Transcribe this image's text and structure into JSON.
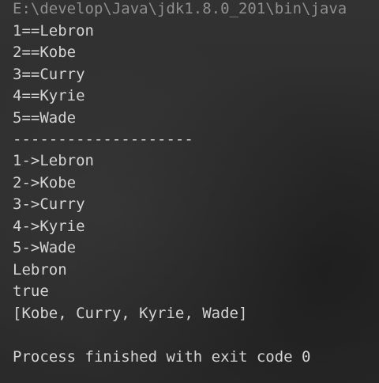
{
  "console": {
    "command": "E:\\develop\\Java\\jdk1.8.0_201\\bin\\java",
    "lines": [
      "1==Lebron",
      "2==Kobe",
      "3==Curry",
      "4==Kyrie",
      "5==Wade",
      "--------------------",
      "1->Lebron",
      "2->Kobe",
      "3->Curry",
      "4->Kyrie",
      "5->Wade",
      "Lebron",
      "true",
      "[Kobe, Curry, Kyrie, Wade]",
      "",
      "Process finished with exit code 0"
    ]
  }
}
